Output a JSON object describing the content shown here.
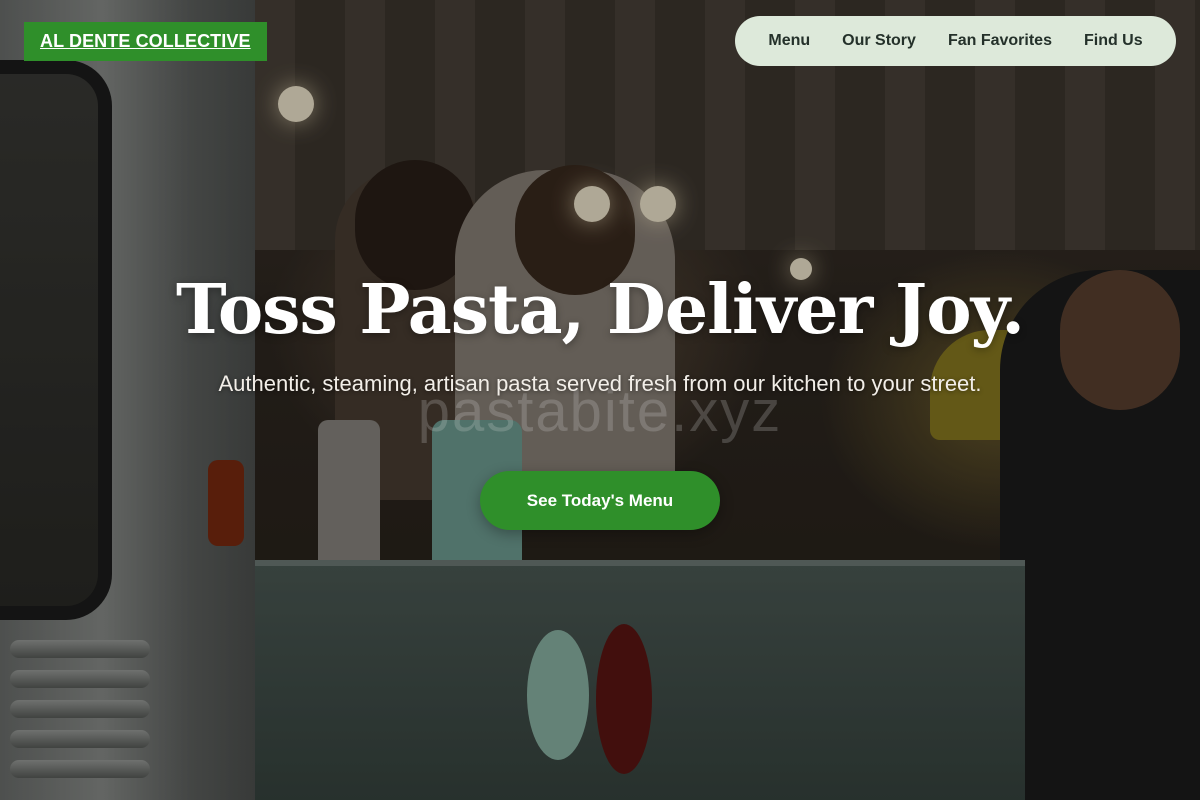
{
  "brand": {
    "logo_text": "AL DENTE COLLECTIVE",
    "accent_color": "#2f8f2a"
  },
  "nav": {
    "background_color": "#dde9da",
    "items": [
      {
        "label": "Menu"
      },
      {
        "label": "Our Story"
      },
      {
        "label": "Fan Favorites"
      },
      {
        "label": "Find Us"
      }
    ]
  },
  "hero": {
    "title": "Toss Pasta, Deliver Joy.",
    "subtitle": "Authentic, steaming, artisan pasta served fresh from our kitchen to your street.",
    "watermark": "pastabite.xyz",
    "cta_label": "See Today's Menu",
    "background_image": "food truck serving window with two cooks and a customer"
  }
}
